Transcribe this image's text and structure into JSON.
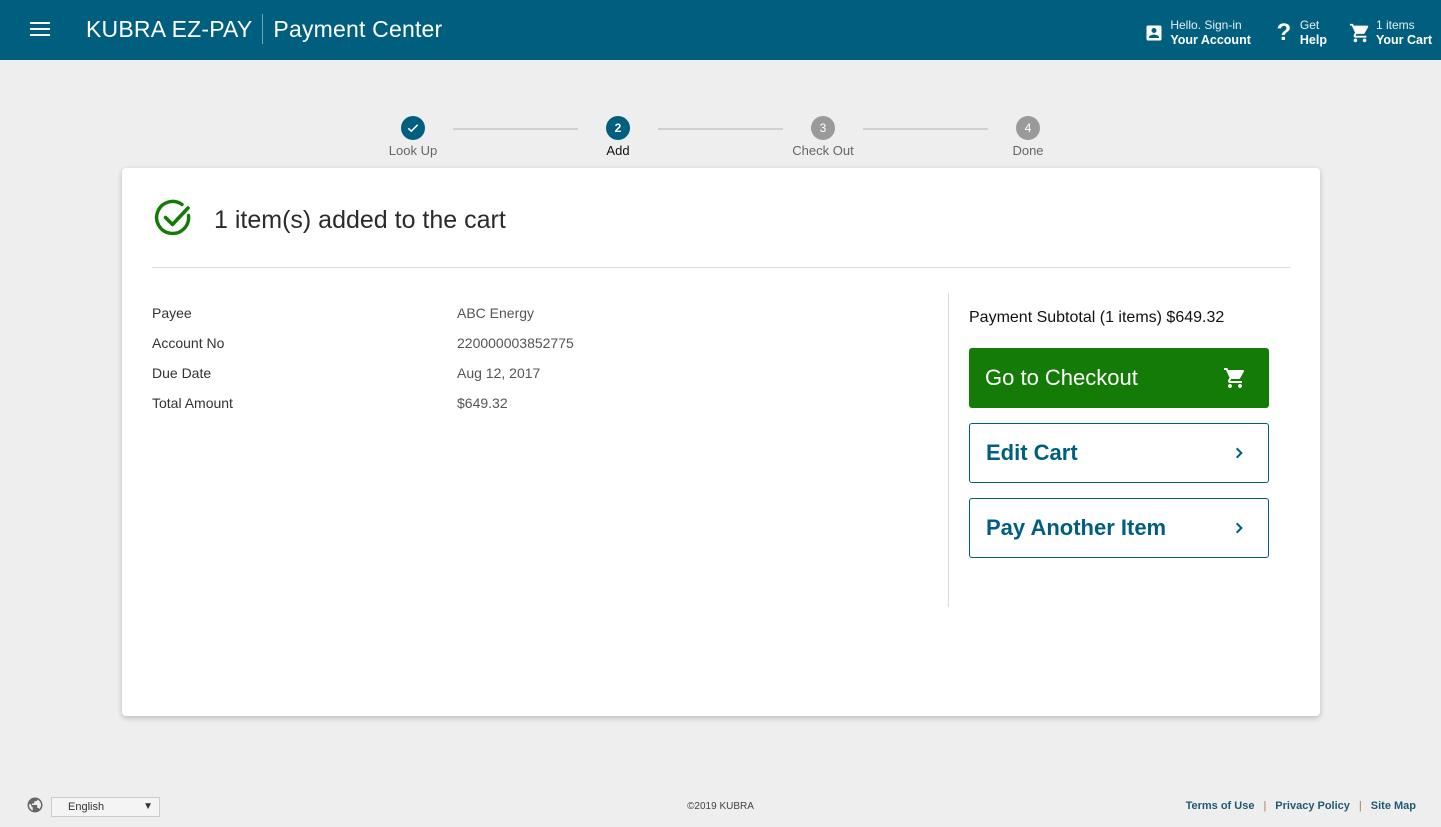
{
  "header": {
    "brand": "KUBRA EZ-PAY",
    "app_name": "Payment Center",
    "account": {
      "small": "Hello. Sign-in",
      "big": "Your Account",
      "icon": "account-box-icon"
    },
    "help": {
      "small": "Get",
      "big": "Help",
      "icon": "question-mark-icon"
    },
    "cart": {
      "small": "1 items",
      "big": "Your Cart",
      "icon": "cart-icon"
    }
  },
  "stepper": {
    "steps": [
      {
        "number": "1",
        "label": "Look Up",
        "state": "done"
      },
      {
        "number": "2",
        "label": "Add",
        "state": "active"
      },
      {
        "number": "3",
        "label": "Check Out",
        "state": "todo"
      },
      {
        "number": "4",
        "label": "Done",
        "state": "todo"
      }
    ]
  },
  "confirmation": {
    "title": "1 item(s) added to the cart",
    "status_color": "#137b06"
  },
  "details": [
    {
      "label": "Payee",
      "value": "ABC Energy"
    },
    {
      "label": "Account No",
      "value": "220000003852775"
    },
    {
      "label": "Due Date",
      "value": "Aug 12, 2017"
    },
    {
      "label": "Total Amount",
      "value": "$649.32"
    }
  ],
  "summary": {
    "subtotal": "Payment Subtotal (1 items) $649.32",
    "checkout_label": "Go to Checkout",
    "edit_cart_label": "Edit Cart",
    "pay_another_label": "Pay Another Item"
  },
  "footer": {
    "language": "English",
    "copyright": "©2019 KUBRA",
    "links": [
      "Terms of Use",
      "Privacy Policy",
      "Site Map"
    ],
    "separator": "|"
  },
  "colors": {
    "brand": "#005f7f",
    "success": "#137b06",
    "background": "#eeeeee"
  }
}
